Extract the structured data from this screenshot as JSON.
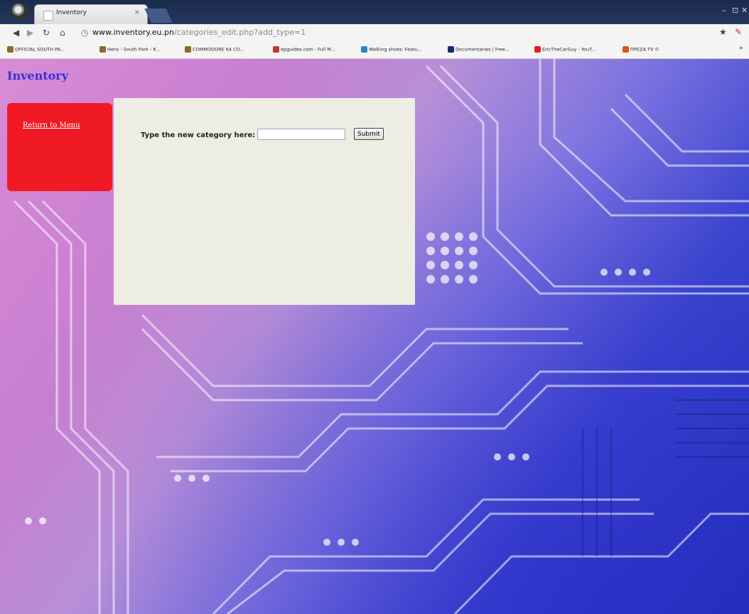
{
  "browser": {
    "tab_title": "Inventory",
    "tab_close": "×",
    "url_host": "www.inventory.eu.pn",
    "url_path": "/categories_edit.php?add_type=1",
    "window_controls": [
      "–",
      "⊡",
      "✕"
    ],
    "bookmarks": [
      {
        "label": "OFFICIAL SOUTH PA...",
        "color": "#8a6a2a"
      },
      {
        "label": "Hens - South Park - K...",
        "color": "#8a6a2a"
      },
      {
        "label": "COMMODORE 64 CO...",
        "color": "#8a6a2a"
      },
      {
        "label": "epguides.com - Full M...",
        "color": "#c0392b"
      },
      {
        "label": "Walking shoes: Featu...",
        "color": "#2e86c1"
      },
      {
        "label": "Documentaries | Free...",
        "color": "#1b2b6a"
      },
      {
        "label": "EricTheCarGuy - YouT...",
        "color": "#e02020"
      },
      {
        "label": "ΠΡΕΖΑ TV ©",
        "color": "#e05020"
      }
    ],
    "overflow": "»"
  },
  "page": {
    "title": "Inventory",
    "menu_link": "Return to Menu",
    "form": {
      "label": "Type the new category here:",
      "input_value": "",
      "submit_label": "Submit"
    }
  },
  "colors": {
    "title": "#3a2fd6",
    "menu_box": "#f01a24",
    "panel": "#eeede4"
  },
  "icons": [
    "back-icon",
    "forward-icon",
    "reload-icon",
    "home-icon",
    "globe-icon",
    "star-icon",
    "extension-icon"
  ]
}
